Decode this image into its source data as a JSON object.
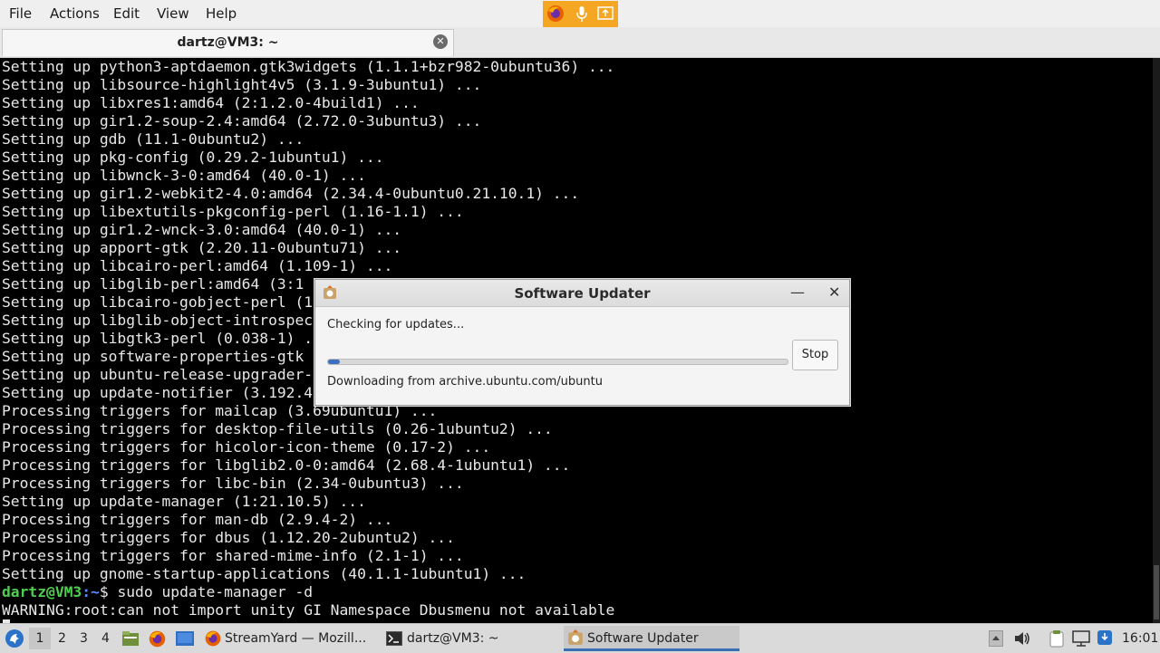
{
  "menubar": {
    "items": [
      "File",
      "Actions",
      "Edit",
      "View",
      "Help"
    ]
  },
  "tab": {
    "title": "dartz@VM3: ~"
  },
  "terminal": {
    "lines": [
      "Setting up python3-aptdaemon.gtk3widgets (1.1.1+bzr982-0ubuntu36) ...",
      "Setting up libsource-highlight4v5 (3.1.9-3ubuntu1) ...",
      "Setting up libxres1:amd64 (2:1.2.0-4build1) ...",
      "Setting up gir1.2-soup-2.4:amd64 (2.72.0-3ubuntu3) ...",
      "Setting up gdb (11.1-0ubuntu2) ...",
      "Setting up pkg-config (0.29.2-1ubuntu1) ...",
      "Setting up libwnck-3-0:amd64 (40.0-1) ...",
      "Setting up gir1.2-webkit2-4.0:amd64 (2.34.4-0ubuntu0.21.10.1) ...",
      "Setting up libextutils-pkgconfig-perl (1.16-1.1) ...",
      "Setting up gir1.2-wnck-3.0:amd64 (40.0-1) ...",
      "Setting up apport-gtk (2.20.11-0ubuntu71) ...",
      "Setting up libcairo-perl:amd64 (1.109-1) ...",
      "Setting up libglib-perl:amd64 (3:1",
      "Setting up libcairo-gobject-perl (1",
      "Setting up libglib-object-introspec",
      "Setting up libgtk3-perl (0.038-1) .",
      "Setting up software-properties-gtk",
      "Setting up ubuntu-release-upgrader-",
      "Setting up update-notifier (3.192.4",
      "Processing triggers for mailcap (3.69ubuntu1) ...",
      "Processing triggers for desktop-file-utils (0.26-1ubuntu2) ...",
      "Processing triggers for hicolor-icon-theme (0.17-2) ...",
      "Processing triggers for libglib2.0-0:amd64 (2.68.4-1ubuntu1) ...",
      "Processing triggers for libc-bin (2.34-0ubuntu3) ...",
      "Setting up update-manager (1:21.10.5) ...",
      "Processing triggers for man-db (2.9.4-2) ...",
      "Processing triggers for dbus (1.12.20-2ubuntu2) ...",
      "Processing triggers for shared-mime-info (2.1-1) ...",
      "Setting up gnome-startup-applications (40.1.1-1ubuntu1) ..."
    ],
    "prompt_user": "dartz@VM3",
    "prompt_path": ":~",
    "prompt_command": "$ sudo update-manager -d",
    "warning": "WARNING:root:can not import unity GI Namespace Dbusmenu not available"
  },
  "dialog": {
    "title": "Software Updater",
    "status": "Checking for updates...",
    "progress_fraction": 0.025,
    "stop_label": "Stop",
    "download_text": "Downloading from archive.ubuntu.com/ubuntu"
  },
  "taskbar": {
    "workspaces": [
      "1",
      "2",
      "3",
      "4"
    ],
    "tasks": [
      {
        "label": "StreamYard — Mozill...",
        "icon": "firefox-icon"
      },
      {
        "label": "dartz@VM3: ~",
        "icon": "terminal-icon"
      },
      {
        "label": "Software Updater",
        "icon": "software-updater-icon"
      }
    ],
    "clock": "16:01"
  }
}
